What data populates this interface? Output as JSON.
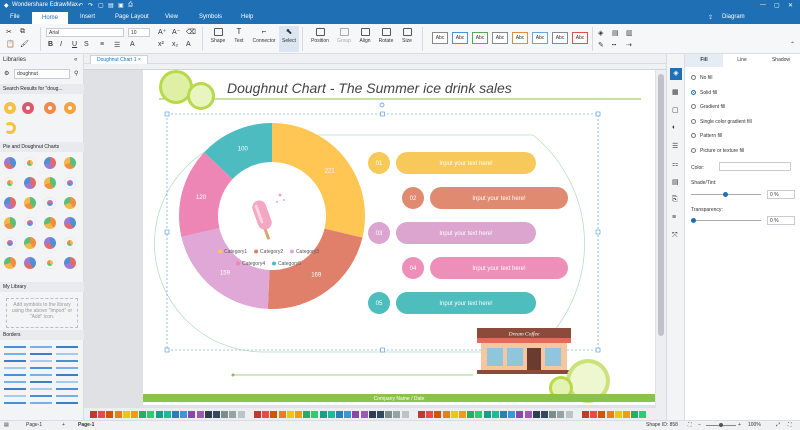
{
  "app": {
    "title": "Wondershare EdrawMax",
    "user": "Diagram"
  },
  "menu": {
    "items": [
      "File",
      "Home",
      "Insert",
      "Page Layout",
      "View",
      "Symbols",
      "Help"
    ],
    "active": "Home"
  },
  "ribbon": {
    "font_name": "Arial",
    "font_size": "10",
    "buttons": [
      "Shape",
      "Text",
      "Connector",
      "Select",
      "Position",
      "Group",
      "Align",
      "Rotate",
      "Size"
    ],
    "style_swatches": [
      "Abc",
      "Abc",
      "Abc",
      "Abc",
      "Abc",
      "Abc",
      "Abc",
      "Abc"
    ]
  },
  "library": {
    "title": "Libraries",
    "search_value": "doughnut",
    "search_results_label": "Search Results for \"doug...",
    "pie_section": "Pie and Doughnut Charts",
    "my_library": "My Library",
    "my_library_hint": "Add symbols to the library using the above \"Import\" or \"Add\" icon.",
    "borders": "Borders"
  },
  "doc_tab": "Doughnut Chart 1",
  "diagram": {
    "title": "Doughnut Chart   -    The Summer ice drink sales",
    "footer": "Company Name / Date",
    "sign": "Dream Coffee",
    "items": [
      {
        "num": "01",
        "text": "Input your text here!",
        "color": "#f7c95a"
      },
      {
        "num": "02",
        "text": "Input your text here!",
        "color": "#e08a72"
      },
      {
        "num": "03",
        "text": "Input your text here!",
        "color": "#dba5cf"
      },
      {
        "num": "04",
        "text": "Input your text here!",
        "color": "#ee8fb9"
      },
      {
        "num": "05",
        "text": "Input your text here!",
        "color": "#4dbdbd"
      }
    ]
  },
  "chart_data": {
    "type": "doughnut",
    "categories": [
      "Category1",
      "Category2",
      "Category3",
      "Category4",
      "Category5"
    ],
    "values": [
      221,
      169,
      159,
      120,
      100
    ],
    "colors": [
      "#ffc653",
      "#e0806a",
      "#e0a8d6",
      "#ee86b5",
      "#4dbcc0"
    ]
  },
  "props": {
    "tabs": [
      "Fill",
      "Line",
      "Shadow"
    ],
    "active_tab": "Fill",
    "fill_options": [
      "No fill",
      "Solid fill",
      "Gradient fill",
      "Single color gradient fill",
      "Pattern fill",
      "Picture or texture fill"
    ],
    "selected_fill": "Solid fill",
    "color_label": "Color:",
    "shade_label": "Shade/Tint:",
    "shade_value": "0 %",
    "transparency_label": "Transparency:",
    "transparency_value": "0 %"
  },
  "status": {
    "page_selector": "Page-1",
    "page_tab": "Page-1",
    "shape_id": "Shape ID: 858",
    "zoom": "100%"
  }
}
